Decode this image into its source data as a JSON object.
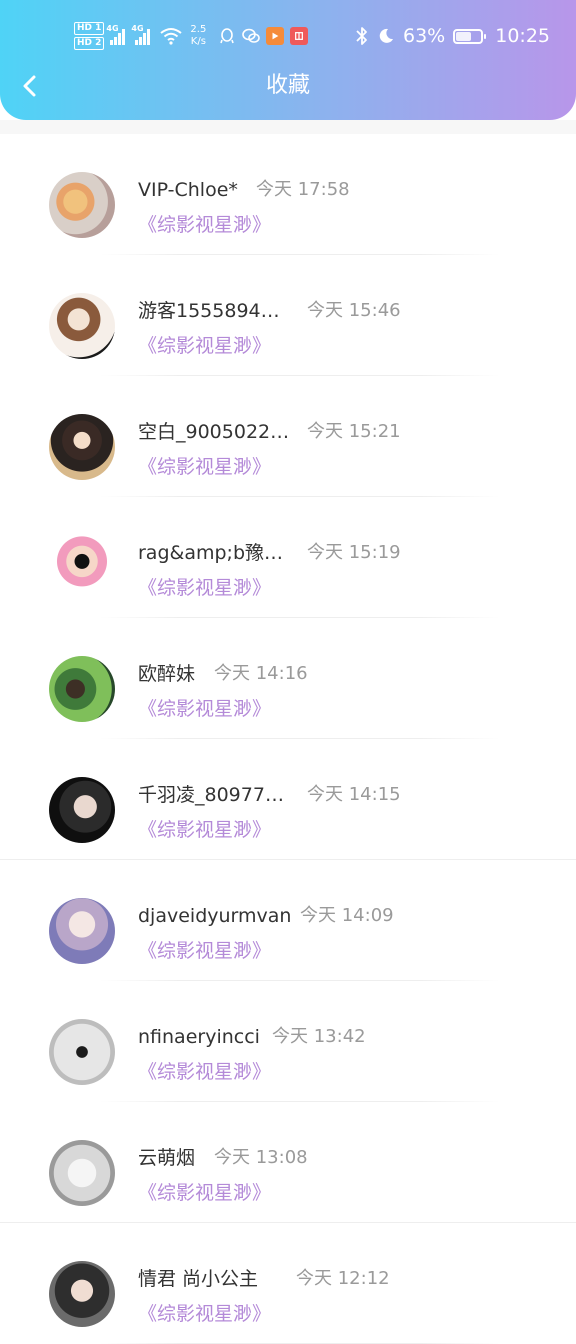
{
  "status_bar": {
    "hd1": "HD 1",
    "hd2": "HD 2",
    "net1": "4G",
    "net2": "4G",
    "speed_value": "2.5",
    "speed_unit": "K/s",
    "battery_percent": "63%",
    "battery_level": 0.63,
    "time": "10:25",
    "icons": [
      "bluetooth-icon",
      "moon-icon"
    ]
  },
  "header": {
    "title": "收藏",
    "back_icon": "chevron-left-icon",
    "gradient": [
      "#4fd3f6",
      "#b896ea"
    ]
  },
  "colors": {
    "name": "#333333",
    "time": "#9a9a9a",
    "book_link": "#b48ad8"
  },
  "items": [
    {
      "name": "VIP-Chloe*",
      "time": "今天 17:58",
      "book": "《综影视星渺》"
    },
    {
      "name": "游客1555894…",
      "time": "今天 15:46",
      "book": "《综影视星渺》"
    },
    {
      "name": "空白_9005022…",
      "time": "今天 15:21",
      "book": "《综影视星渺》"
    },
    {
      "name": "rag&amp;b豫…",
      "time": "今天 15:19",
      "book": "《综影视星渺》"
    },
    {
      "name": "欧醉妹",
      "time": "今天 14:16",
      "book": "《综影视星渺》"
    },
    {
      "name": "千羽凌_80977…",
      "time": "今天 14:15",
      "book": "《综影视星渺》"
    },
    {
      "name": "djaveidyurmvan",
      "time": "今天 14:09",
      "book": "《综影视星渺》"
    },
    {
      "name": "nfinaeryincci",
      "time": "今天 13:42",
      "book": "《综影视星渺》"
    },
    {
      "name": "云萌烟",
      "time": "今天 13:08",
      "book": "《综影视星渺》"
    },
    {
      "name": "情君 尚小公主",
      "time": "今天 12:12",
      "book": "《综影视星渺》"
    }
  ]
}
